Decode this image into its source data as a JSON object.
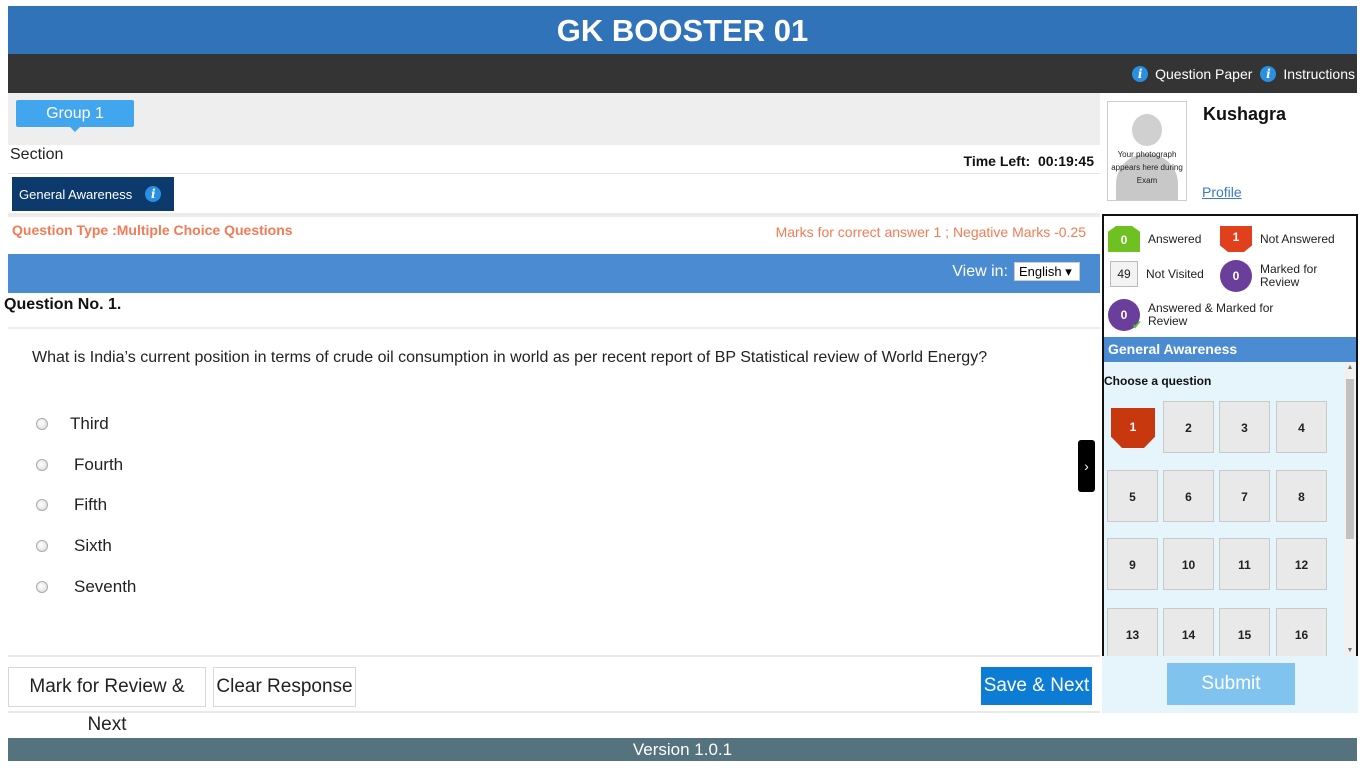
{
  "header": {
    "title": "GK BOOSTER 01"
  },
  "topbar": {
    "question_paper": "Question Paper",
    "instructions": "Instructions"
  },
  "groups": {
    "active": "Group 1"
  },
  "section": {
    "label": "Section",
    "active_tab": "General Awareness"
  },
  "timer": {
    "label": "Time Left:",
    "value": "00:19:45"
  },
  "question_meta": {
    "type_label": "Question Type  :Multiple Choice Questions",
    "marks": "Marks for correct answer 1  ;  Negative Marks -0.25"
  },
  "view_in": {
    "label": "View in:",
    "language": "English ▾"
  },
  "question": {
    "number": "Question No. 1.",
    "text": "What is India’s current position in terms of crude oil consumption in world as per recent report of BP Statistical review of World Energy?",
    "options": [
      "Third",
      "Fourth",
      "Fifth",
      "Sixth",
      "Seventh"
    ]
  },
  "actions": {
    "mark_review": "Mark for Review & Next",
    "clear": "Clear Response",
    "save_next": "Save & Next",
    "submit": "Submit"
  },
  "candidate": {
    "photo_text": "Your photograph appears here during Exam",
    "name": "Kushagra",
    "profile_link": "Profile"
  },
  "legend": {
    "answered": {
      "count": "0",
      "label": "Answered"
    },
    "not_answered": {
      "count": "1",
      "label": "Not Answered"
    },
    "not_visited": {
      "count": "49",
      "label": "Not Visited"
    },
    "marked": {
      "count": "0",
      "label": "Marked for Review"
    },
    "answered_marked": {
      "count": "0",
      "label": "Answered & Marked for Review"
    }
  },
  "palette": {
    "section": "General Awareness",
    "choose": "Choose a question",
    "questions": [
      "1",
      "2",
      "3",
      "4",
      "5",
      "6",
      "7",
      "8",
      "9",
      "10",
      "11",
      "12",
      "13",
      "14",
      "15",
      "16"
    ]
  },
  "footer": {
    "version": "Version 1.0.1"
  },
  "colors": {
    "header_blue": "#3173b9",
    "accent_orange": "#f27b55",
    "answered_green": "#6fc021",
    "not_answered_red": "#e0401b",
    "marked_purple": "#6a3f9b",
    "save_blue": "#0c7cd5"
  }
}
